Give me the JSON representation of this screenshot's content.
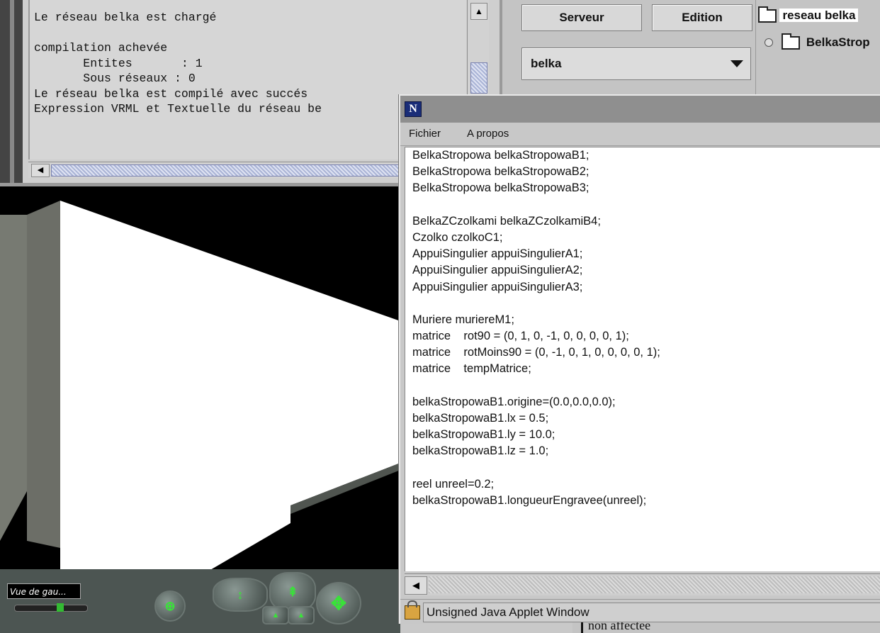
{
  "console": {
    "lines": [
      "Le réseau belka est chargé",
      "",
      "compilation achevée",
      "       Entites       : 1",
      "       Sous réseaux : 0",
      "Le réseau belka est compilé avec succés",
      "Expression VRML et Textuelle du réseau be"
    ]
  },
  "toolbar": {
    "serveur_label": "Serveur",
    "edition_label": "Edition"
  },
  "network_select": {
    "value": "belka"
  },
  "tree": {
    "root_label": "reseau belka",
    "child_label": "BelkaStrop"
  },
  "viewer": {
    "view_label": "Vue de gau..."
  },
  "applet": {
    "logo_letter": "N",
    "menu": {
      "fichier": "Fichier",
      "apropos": "A propos"
    },
    "code_lines": [
      "BelkaStropowa belkaStropowaB1;",
      "BelkaStropowa belkaStropowaB2;",
      "BelkaStropowa belkaStropowaB3;",
      "",
      "BelkaZCzolkami belkaZCzolkamiB4;",
      "Czolko czolkoC1;",
      "AppuiSingulier appuiSingulierA1;",
      "AppuiSingulier appuiSingulierA2;",
      "AppuiSingulier appuiSingulierA3;",
      "",
      "Muriere muriereM1;",
      "matrice    rot90 = (0, 1, 0, -1, 0, 0, 0, 0, 1);",
      "matrice    rotMoins90 = (0, -1, 0, 1, 0, 0, 0, 0, 1);",
      "matrice    tempMatrice;",
      "",
      "belkaStropowaB1.origine=(0.0,0.0,0.0);",
      "belkaStropowaB1.lx = 0.5;",
      "belkaStropowaB1.ly = 10.0;",
      "belkaStropowaB1.lz = 1.0;",
      "",
      "reel unreel=0.2;",
      "belkaStropowaB1.longueurEngravee(unreel);"
    ],
    "status_text": "Unsigned Java Applet Window"
  },
  "background_window": {
    "text": "non affectee"
  }
}
